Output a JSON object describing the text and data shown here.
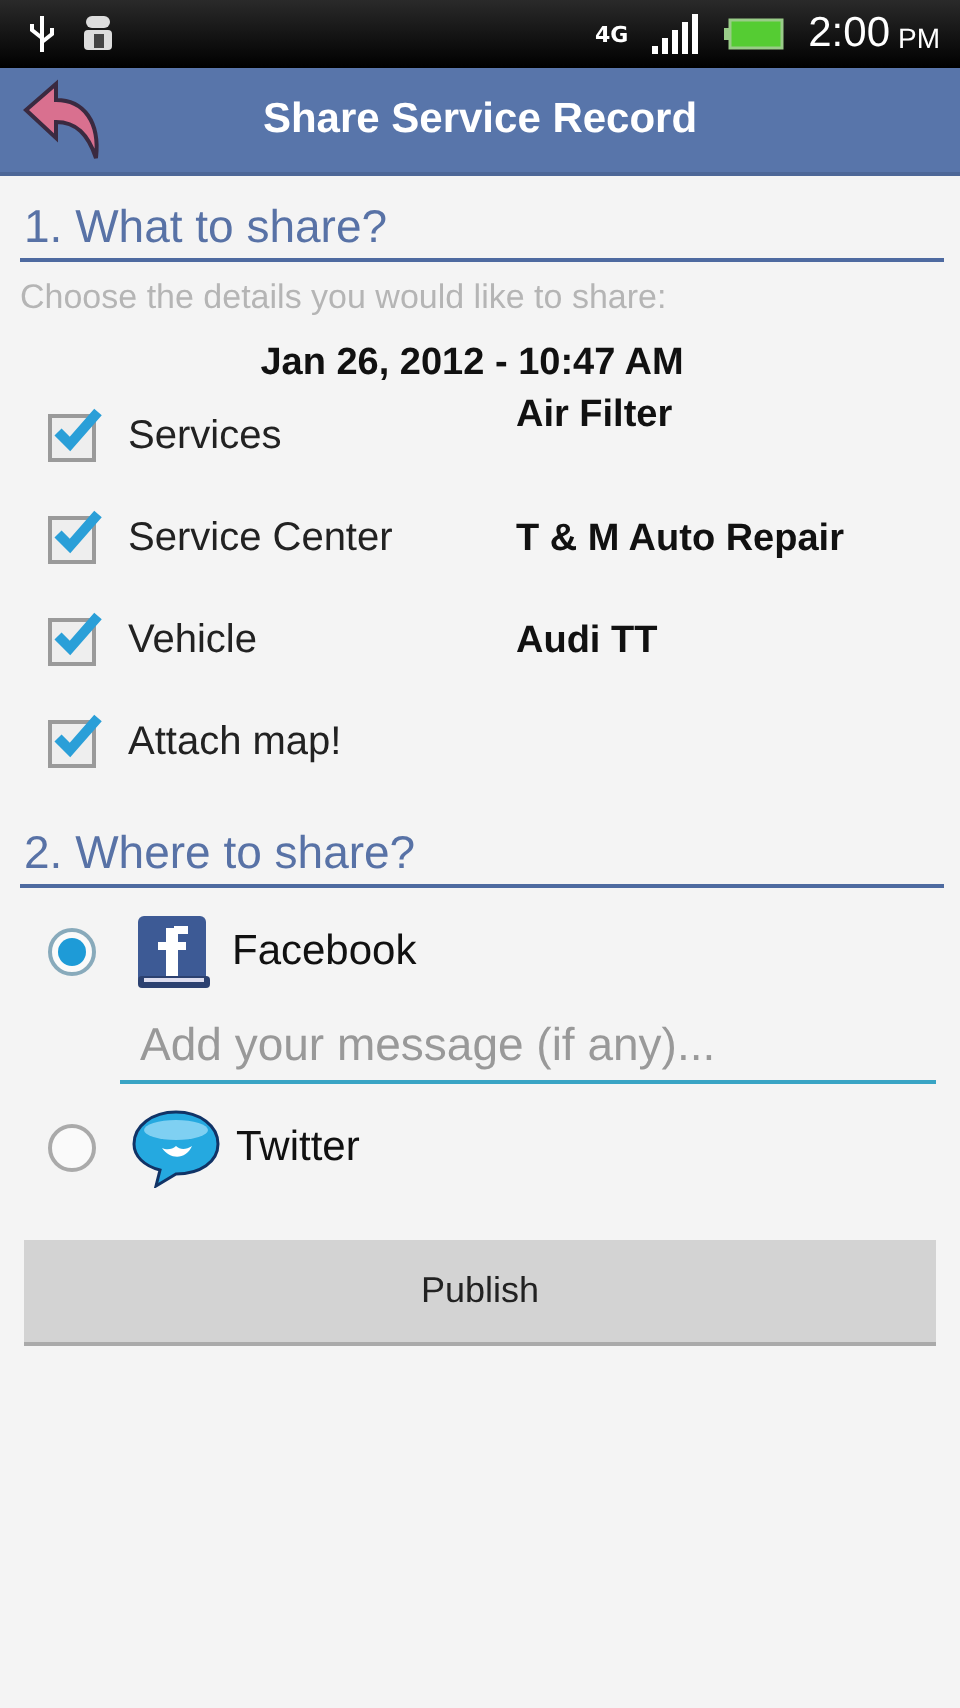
{
  "status_bar": {
    "network": "4G",
    "time": "2:00",
    "ampm": "PM"
  },
  "header": {
    "title": "Share Service Record"
  },
  "what_section": {
    "title": "1. What to share?",
    "hint": "Choose the details you would like to share:",
    "date": "Jan 26, 2012 - 10:47 AM",
    "items": [
      {
        "label": "Services",
        "value": "Air Filter",
        "checked": true
      },
      {
        "label": "Service Center",
        "value": "T & M Auto Repair",
        "checked": true
      },
      {
        "label": "Vehicle",
        "value": "Audi TT",
        "checked": true
      },
      {
        "label": "Attach map!",
        "checked": true
      }
    ]
  },
  "where_section": {
    "title": "2. Where to share?",
    "options": [
      {
        "kind": "facebook",
        "label": "Facebook",
        "selected": true
      },
      {
        "kind": "twitter",
        "label": "Twitter",
        "selected": false
      }
    ],
    "message": {
      "placeholder": "Add your message (if any)..."
    }
  },
  "publish_button": "Publish"
}
